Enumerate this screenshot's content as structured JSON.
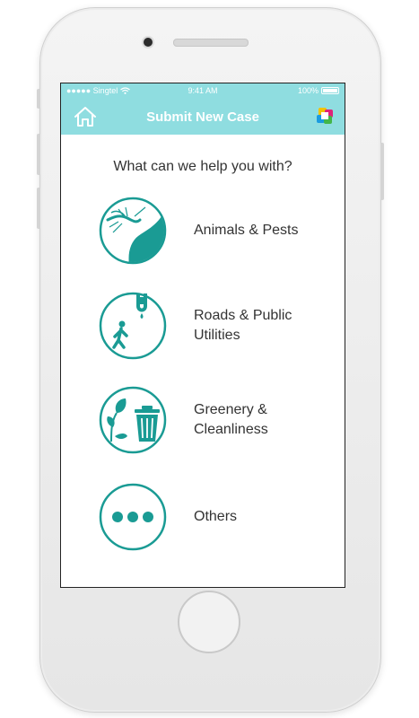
{
  "status_bar": {
    "carrier": "●●●●● Singtel",
    "time": "9:41 AM",
    "battery": "100%"
  },
  "header": {
    "title": "Submit New Case",
    "home_icon": "home-icon",
    "logo_icon": "app-logo-icon"
  },
  "prompt": "What can we help you with?",
  "categories": [
    {
      "line1": "Animals & Pests",
      "line2": "",
      "icon": "mosquito-icon"
    },
    {
      "line1": "Roads & Public",
      "line2": "Utilities",
      "icon": "pedestrian-pipe-icon"
    },
    {
      "line1": "Greenery &",
      "line2": "Cleanliness",
      "icon": "leaf-trash-icon"
    },
    {
      "line1": "Others",
      "line2": "",
      "icon": "more-dots-icon"
    }
  ],
  "colors": {
    "accent": "#8fdde0",
    "icon_teal": "#1a9b94",
    "text": "#333333"
  }
}
